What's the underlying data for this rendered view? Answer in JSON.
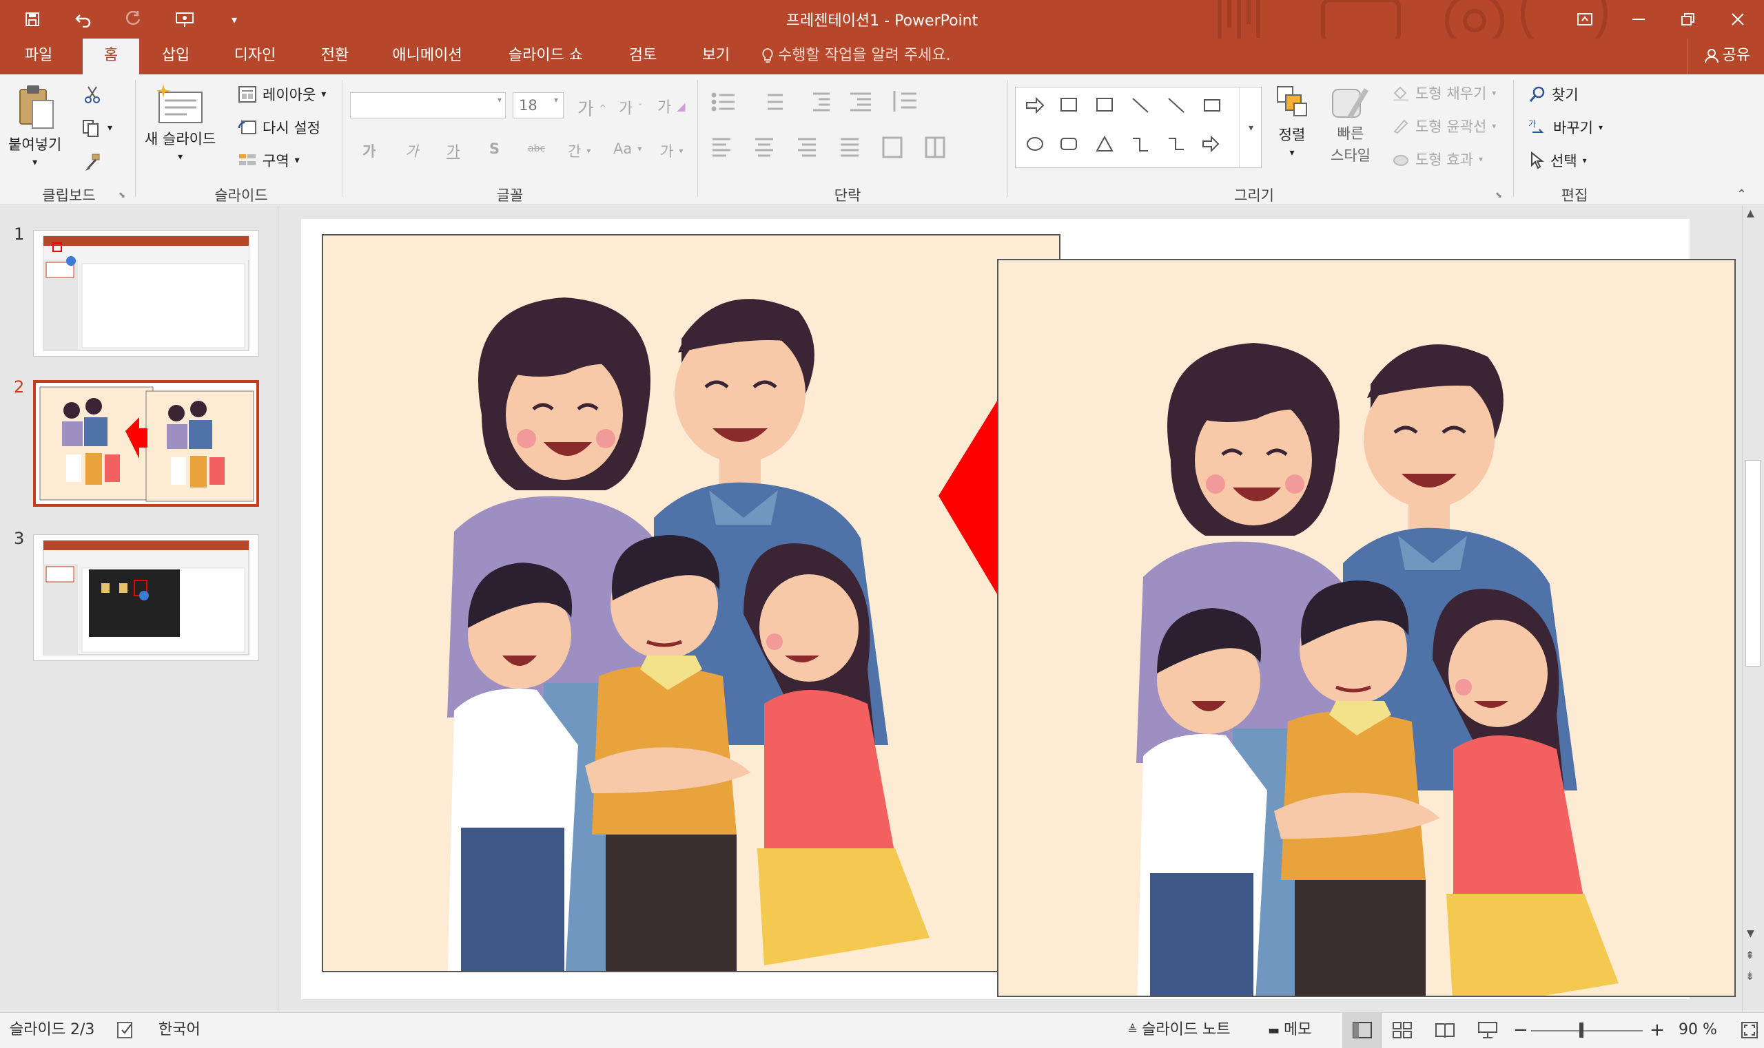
{
  "window": {
    "title": "프레젠테이션1 - PowerPoint",
    "accent": "#b7472a"
  },
  "qat": {
    "icons": [
      "save-icon",
      "undo-icon",
      "redo-icon",
      "presentation-icon",
      "customize-icon"
    ]
  },
  "tabs": [
    {
      "label": "파일"
    },
    {
      "label": "홈"
    },
    {
      "label": "삽입"
    },
    {
      "label": "디자인"
    },
    {
      "label": "전환"
    },
    {
      "label": "애니메이션"
    },
    {
      "label": "슬라이드 쇼"
    },
    {
      "label": "검토"
    },
    {
      "label": "보기"
    }
  ],
  "tell_me": "수행할 작업을 알려 주세요.",
  "share": "공유",
  "ribbon": {
    "clipboard": {
      "paste": "붙여넣기",
      "group": "클립보드"
    },
    "slides": {
      "new_slide": "새 슬라이드",
      "layout": "레이아웃",
      "reset": "다시 설정",
      "section": "구역",
      "group": "슬라이드"
    },
    "font": {
      "font_name": "",
      "font_size": "18",
      "bold": "가",
      "italic": "가",
      "underline": "가",
      "shadow": "S",
      "strike": "abc",
      "spacing": "간",
      "case": "Aa",
      "color": "가",
      "group": "글꼴"
    },
    "paragraph": {
      "group": "단락"
    },
    "drawing": {
      "arrange": "정렬",
      "quick_styles_1": "빠른",
      "quick_styles_2": "스타일",
      "fill": "도형 채우기",
      "outline": "도형 윤곽선",
      "effects": "도형 효과",
      "group": "그리기"
    },
    "editing": {
      "find": "찾기",
      "replace": "바꾸기",
      "select": "선택",
      "group": "편집"
    }
  },
  "thumbnails": [
    {
      "number": "1"
    },
    {
      "number": "2"
    },
    {
      "number": "3"
    }
  ],
  "status": {
    "slide_indicator": "슬라이드 2/3",
    "language": "한국어",
    "notes": "슬라이드 노트",
    "comments": "메모",
    "zoom": "90 %"
  }
}
